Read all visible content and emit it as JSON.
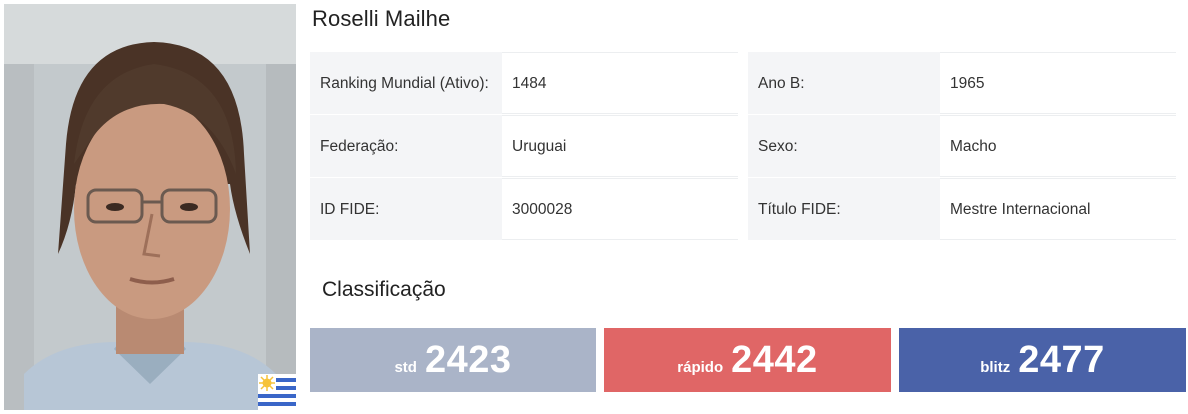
{
  "player": {
    "name": "Roselli Mailhe",
    "photo_alt": "player-photo",
    "flag_icon": "uruguay-flag-icon"
  },
  "info": {
    "rows": [
      {
        "left_label": "Ranking Mundial (Ativo):",
        "left_value": "1484",
        "right_label": "Ano B:",
        "right_value": "1965"
      },
      {
        "left_label": "Federação:",
        "left_value": "Uruguai",
        "right_label": "Sexo:",
        "right_value": "Macho"
      },
      {
        "left_label": "ID FIDE:",
        "left_value": "3000028",
        "right_label": "Título FIDE:",
        "right_value": "Mestre Internacional"
      }
    ]
  },
  "classification": {
    "title": "Classificação",
    "ratings": [
      {
        "label": "std",
        "value": "2423",
        "color": "#aab4c8"
      },
      {
        "label": "rápido",
        "value": "2442",
        "color": "#e06666"
      },
      {
        "label": "blitz",
        "value": "2477",
        "color": "#4a62a8"
      }
    ]
  }
}
